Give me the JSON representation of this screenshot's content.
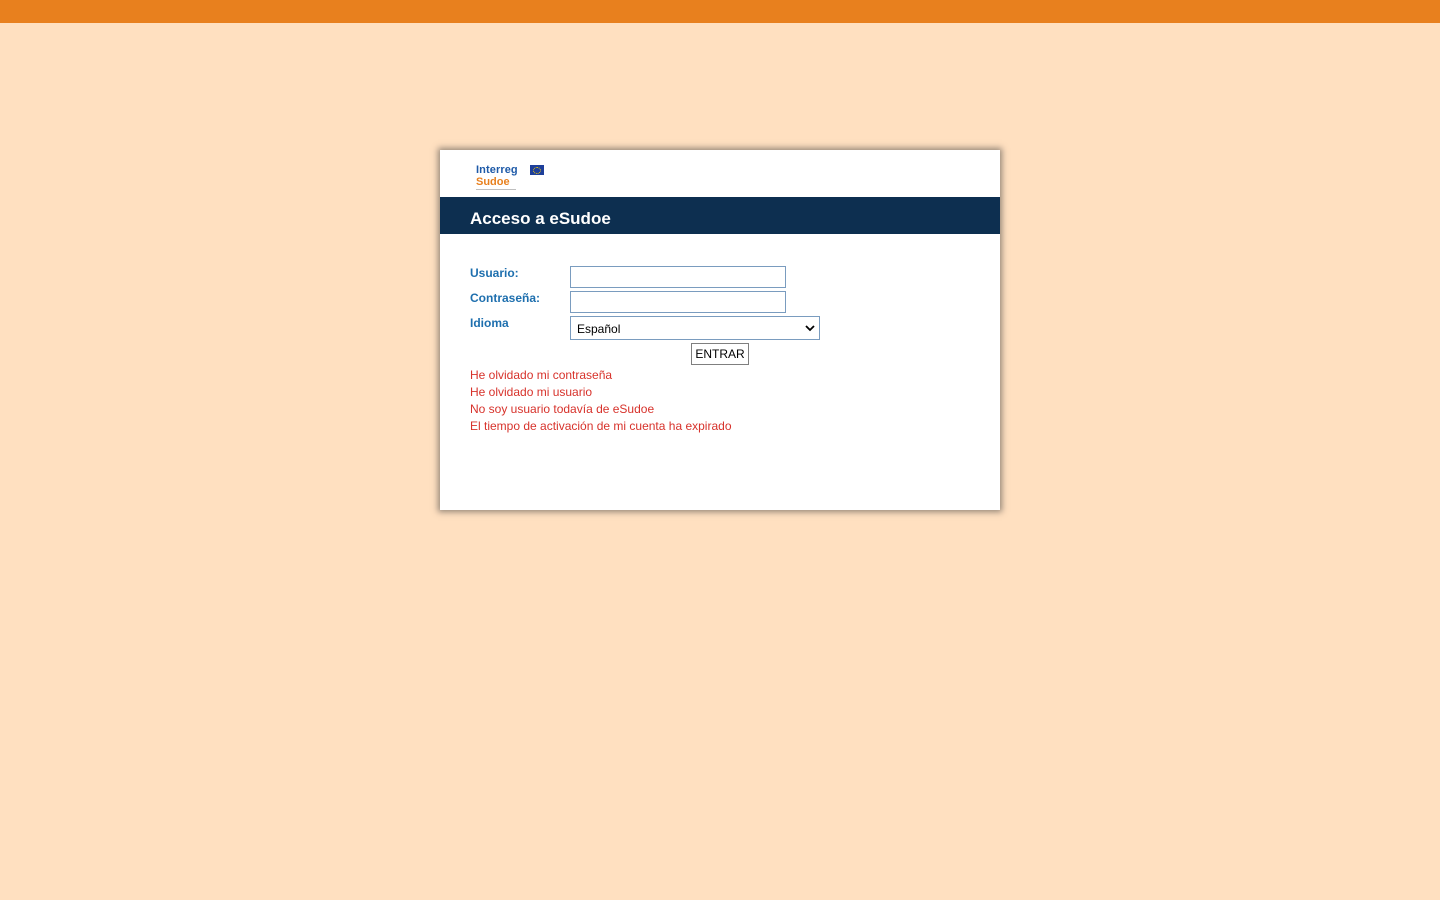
{
  "colors": {
    "page_background": "#ffe0c0",
    "top_bar": "#e8801e",
    "header_bar": "#0d2f50",
    "label": "#1e6fae",
    "link": "#d7322b"
  },
  "logo": {
    "line1": "Interreg",
    "line2": "Sudoe",
    "icon": "eu-flag-icon"
  },
  "card": {
    "title": "Acceso a eSudoe"
  },
  "form": {
    "user_label": "Usuario:",
    "user_value": "",
    "password_label": "Contraseña:",
    "password_value": "",
    "language_label": "Idioma",
    "language_selected": "Español",
    "submit_label": "ENTRAR"
  },
  "links": [
    "He olvidado mi contraseña",
    "He olvidado mi usuario",
    "No soy usuario todavía de eSudoe",
    "El tiempo de activación de mi cuenta ha expirado"
  ]
}
